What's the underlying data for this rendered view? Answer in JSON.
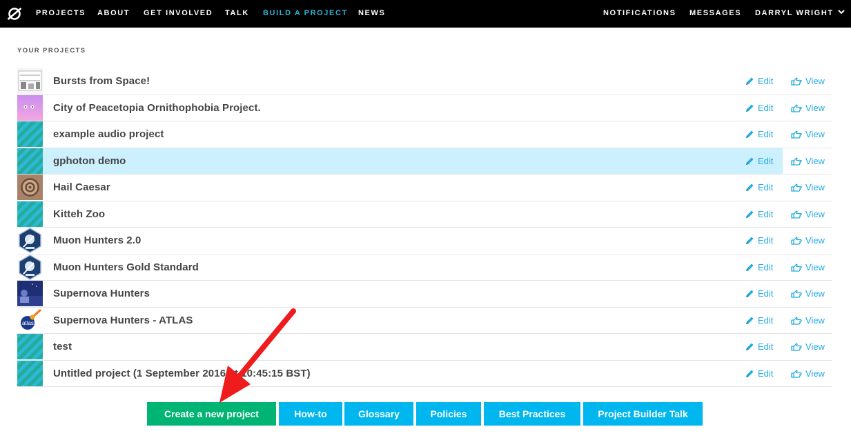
{
  "nav": {
    "logo_icon": "zooniverse-logo-icon",
    "links": [
      "PROJECTS",
      "ABOUT",
      "GET INVOLVED",
      "TALK",
      "BUILD A PROJECT",
      "NEWS"
    ],
    "active": "BUILD A PROJECT",
    "right": [
      "NOTIFICATIONS",
      "MESSAGES",
      "DARRYL WRIGHT"
    ],
    "caret_icon": "chevron-down-icon"
  },
  "section_label": "YOUR PROJECTS",
  "projects": [
    {
      "name": "Bursts from Space!",
      "thumb": "chart-thumbnail"
    },
    {
      "name": "City of Peacetopia Ornithophobia Project.",
      "thumb": "pink-sky-thumbnail"
    },
    {
      "name": "example audio project",
      "thumb": "default-stripes"
    },
    {
      "name": "gphoton demo",
      "thumb": "default-stripes"
    },
    {
      "name": "Hail Caesar",
      "thumb": "coin-thumbnail"
    },
    {
      "name": "Kitteh Zoo",
      "thumb": "default-stripes"
    },
    {
      "name": "Muon Hunters 2.0",
      "thumb": "telescope-hexagon"
    },
    {
      "name": "Muon Hunters Gold Standard",
      "thumb": "telescope-hexagon"
    },
    {
      "name": "Supernova Hunters",
      "thumb": "observatory-photo"
    },
    {
      "name": "Supernova Hunters - ATLAS",
      "thumb": "atlas-logo"
    },
    {
      "name": "test",
      "thumb": "default-stripes"
    },
    {
      "name": "Untitled project (1 September 2016 at 10:45:15 BST)",
      "thumb": "default-stripes"
    }
  ],
  "highlighted_row": "gphoton demo",
  "actions": {
    "edit": "Edit",
    "view": "View",
    "edit_icon": "pencil-icon",
    "view_icon": "hand-pointer-icon"
  },
  "buttons": [
    "Create a new project",
    "How-to",
    "Glossary",
    "Policies",
    "Best Practices",
    "Project Builder Talk"
  ],
  "colors": {
    "nav_bg": "#000000",
    "accent": "#25b5d6",
    "link": "#23a9e1",
    "highlight": "#ccf0fd",
    "primary_button": "#00b473",
    "secondary_button": "#00b6ef",
    "annotation_arrow": "#ee1c1c"
  }
}
